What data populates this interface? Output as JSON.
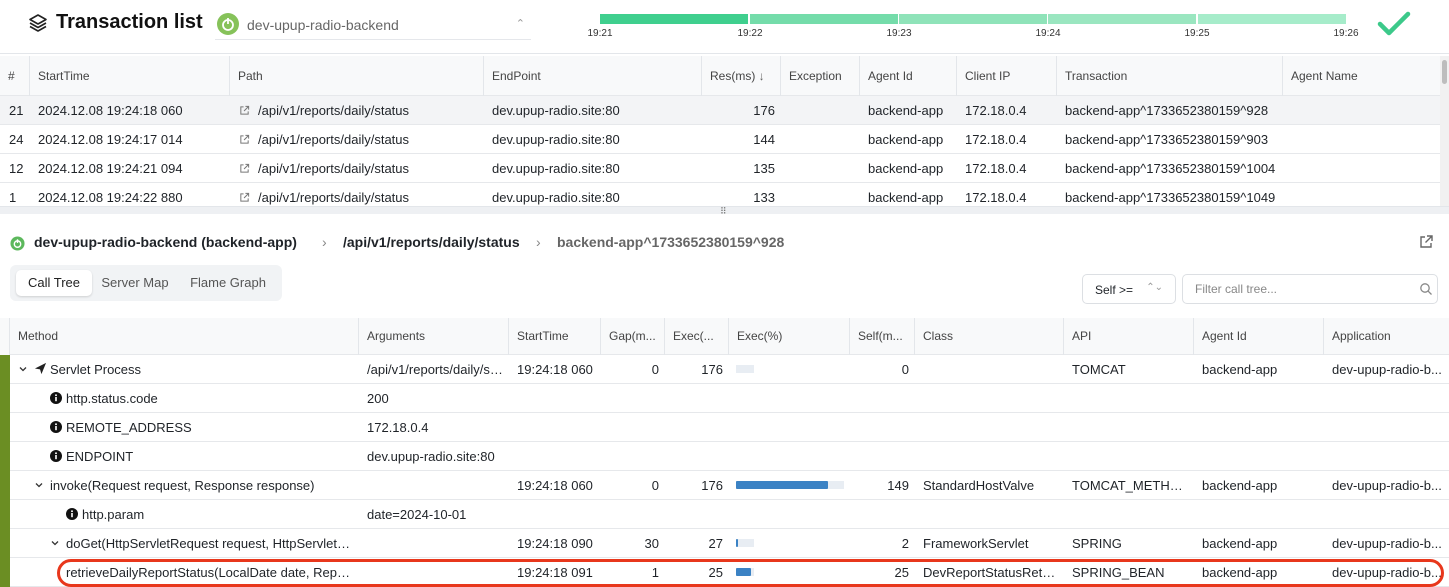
{
  "header": {
    "title": "Transaction list",
    "app_name": "dev-upup-radio-backend",
    "timeline_labels": [
      "19:21",
      "19:22",
      "19:23",
      "19:24",
      "19:25",
      "19:26"
    ],
    "colors": {
      "timeline_dark": "#3fcf8e",
      "timeline_light": "#a6ecca",
      "check": "#3cc98a"
    }
  },
  "transactions": {
    "columns": [
      "#",
      "StartTime",
      "Path",
      "EndPoint",
      "Res(ms)",
      "Exception",
      "Agent Id",
      "Client IP",
      "Transaction",
      "Agent Name"
    ],
    "sort_column": "Res(ms)",
    "rows": [
      {
        "num": "21",
        "start": "2024.12.08 19:24:18 060",
        "path": "/api/v1/reports/daily/status",
        "endpoint": "dev.upup-radio.site:80",
        "res": "176",
        "exception": "",
        "agent": "backend-app",
        "ip": "172.18.0.4",
        "tx": "backend-app^1733652380159^928",
        "agent_name": "",
        "selected": true
      },
      {
        "num": "24",
        "start": "2024.12.08 19:24:17 014",
        "path": "/api/v1/reports/daily/status",
        "endpoint": "dev.upup-radio.site:80",
        "res": "144",
        "exception": "",
        "agent": "backend-app",
        "ip": "172.18.0.4",
        "tx": "backend-app^1733652380159^903",
        "agent_name": ""
      },
      {
        "num": "12",
        "start": "2024.12.08 19:24:21 094",
        "path": "/api/v1/reports/daily/status",
        "endpoint": "dev.upup-radio.site:80",
        "res": "135",
        "exception": "",
        "agent": "backend-app",
        "ip": "172.18.0.4",
        "tx": "backend-app^1733652380159^1004",
        "agent_name": ""
      },
      {
        "num": "1",
        "start": "2024.12.08 19:24:22 880",
        "path": "/api/v1/reports/daily/status",
        "endpoint": "dev.upup-radio.site:80",
        "res": "133",
        "exception": "",
        "agent": "backend-app",
        "ip": "172.18.0.4",
        "tx": "backend-app^1733652380159^1049",
        "agent_name": ""
      }
    ]
  },
  "breadcrumb": {
    "app": "dev-upup-radio-backend (backend-app)",
    "path": "/api/v1/reports/daily/status",
    "tx": "backend-app^1733652380159^928"
  },
  "tabs": [
    "Call Tree",
    "Server Map",
    "Flame Graph"
  ],
  "active_tab": "Call Tree",
  "filter": {
    "self_label": "Self >=",
    "placeholder": "Filter call tree..."
  },
  "calltree": {
    "columns": [
      "Method",
      "Arguments",
      "StartTime",
      "Gap(m...",
      "Exec(...",
      "Exec(%)",
      "Self(m...",
      "Class",
      "API",
      "Agent Id",
      "Application"
    ],
    "rows": [
      {
        "depth": 0,
        "kind": "expand",
        "icon": "send-icon",
        "method": "Servlet Process",
        "args": "/api/v1/reports/daily/st...",
        "start": "19:24:18 060",
        "gap": "0",
        "exec": "176",
        "pct": 0,
        "self": "0",
        "cls": "",
        "api": "TOMCAT",
        "agent": "backend-app",
        "app": "dev-upup-radio-b..."
      },
      {
        "depth": 1,
        "kind": "info",
        "method": "http.status.code",
        "args": "200",
        "start": "",
        "gap": "",
        "exec": "",
        "pct": null,
        "self": "",
        "cls": "",
        "api": "",
        "agent": "",
        "app": ""
      },
      {
        "depth": 1,
        "kind": "info",
        "method": "REMOTE_ADDRESS",
        "args": "172.18.0.4",
        "start": "",
        "gap": "",
        "exec": "",
        "pct": null,
        "self": "",
        "cls": "",
        "api": "",
        "agent": "",
        "app": ""
      },
      {
        "depth": 1,
        "kind": "info",
        "method": "ENDPOINT",
        "args": "dev.upup-radio.site:80",
        "start": "",
        "gap": "",
        "exec": "",
        "pct": null,
        "self": "",
        "cls": "",
        "api": "",
        "agent": "",
        "app": ""
      },
      {
        "depth": 1,
        "kind": "expand",
        "method": "invoke(Request request, Response response)",
        "args": "",
        "start": "19:24:18 060",
        "gap": "0",
        "exec": "176",
        "pct": 0.85,
        "self": "149",
        "cls": "StandardHostValve",
        "api": "TOMCAT_METHOD",
        "agent": "backend-app",
        "app": "dev-upup-radio-b..."
      },
      {
        "depth": 2,
        "kind": "info",
        "method": "http.param",
        "args": "date=2024-10-01",
        "start": "",
        "gap": "",
        "exec": "",
        "pct": null,
        "self": "",
        "cls": "",
        "api": "",
        "agent": "",
        "app": ""
      },
      {
        "depth": 2,
        "kind": "expand",
        "method": "doGet(HttpServletRequest request, HttpServletR...",
        "args": "",
        "start": "19:24:18 090",
        "gap": "30",
        "exec": "27",
        "pct": 0.02,
        "self": "2",
        "cls": "FrameworkServlet",
        "api": "SPRING",
        "agent": "backend-app",
        "app": "dev-upup-radio-b..."
      },
      {
        "depth": 3,
        "kind": "leaf",
        "method": "retrieveDailyReportStatus(LocalDate date, Repor...",
        "args": "",
        "start": "19:24:18 091",
        "gap": "1",
        "exec": "25",
        "pct": 0.14,
        "self": "25",
        "cls": "DevReportStatusRetri...",
        "api": "SPRING_BEAN",
        "agent": "backend-app",
        "app": "dev-upup-radio-b...",
        "highlighted": true
      }
    ]
  }
}
